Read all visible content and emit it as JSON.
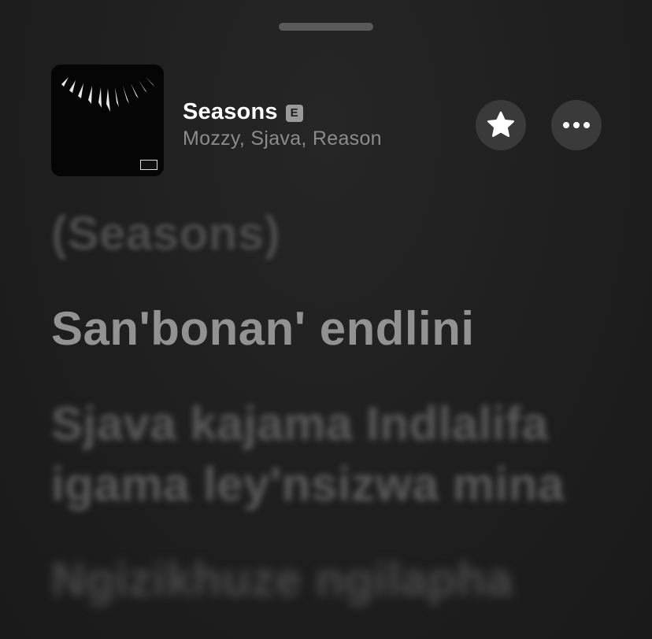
{
  "now_playing": {
    "title": "Seasons",
    "explicit_badge": "E",
    "artists": "Mozzy, Sjava, Reason",
    "artwork_icon": "album-artwork-claw-necklace",
    "advisory_icon": "parental-advisory-icon"
  },
  "actions": {
    "favorite_icon": "star-icon",
    "more_icon": "more-dots-icon"
  },
  "lyrics": {
    "past": "(Seasons)",
    "current": "San'bonan' endlini",
    "next": "Sjava kajama Indlalifa igama ley'nsizwa mina",
    "later": "Ngizikhuze ngilapha"
  },
  "colors": {
    "background": "#1f1f1f",
    "title": "#ffffff",
    "subtitle": "#8c8c8c",
    "button_bg": "#3a3a3a",
    "current_lyric": "#929292"
  }
}
